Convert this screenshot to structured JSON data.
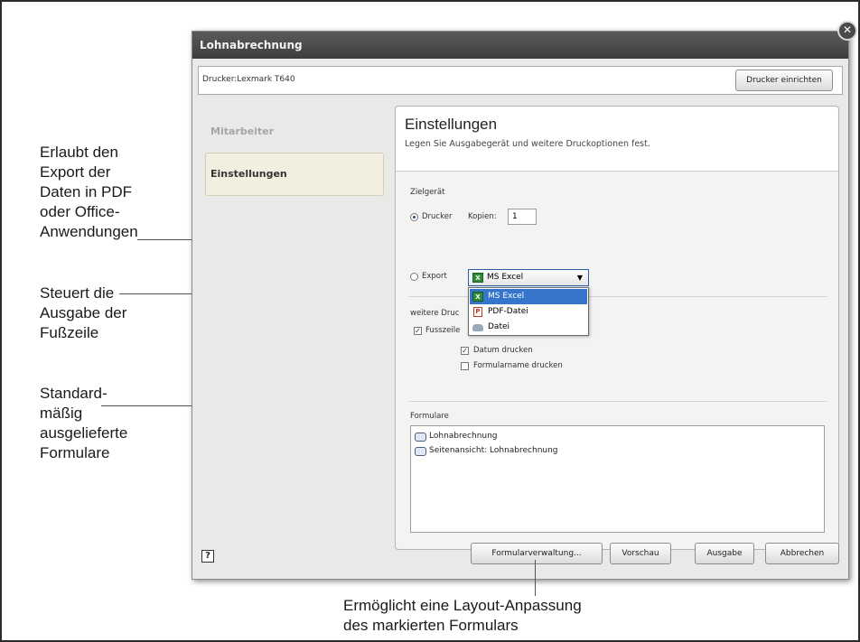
{
  "annotations": {
    "export": [
      "Erlaubt den",
      "Export der",
      "Daten in PDF",
      "oder Office-",
      "Anwendungen"
    ],
    "footer": [
      "Steuert die",
      "Ausgabe der",
      "Fußzeile"
    ],
    "forms": [
      "Standard-",
      "mäßig",
      "ausgelieferte",
      "Formulare"
    ],
    "layout": [
      "Ermöglicht eine Layout-Anpassung",
      "des markierten Formulars"
    ]
  },
  "dialog": {
    "title": "Lohnabrechnung",
    "close_glyph": "✕",
    "printer_label": "Drucker:Lexmark T640",
    "setup_printer_button": "Drucker einrichten"
  },
  "nav": {
    "items": [
      {
        "label": "Mitarbeiter",
        "active": false
      },
      {
        "label": "Einstellungen",
        "active": true
      }
    ]
  },
  "settings": {
    "title": "Einstellungen",
    "subtitle": "Legen Sie Ausgabegerät und weitere Druckoptionen fest.",
    "target_label": "Zielgerät",
    "radio_printer": "Drucker",
    "copies_label": "Kopien:",
    "copies_value": "1",
    "radio_export": "Export",
    "export_selected": "MS Excel",
    "export_options": [
      "MS Excel",
      "PDF-Datei",
      "Datei"
    ],
    "more_options_label": "weitere Druc",
    "footer_checkbox": "Fusszeile",
    "date_checkbox": "Datum drucken",
    "formname_checkbox": "Formularname drucken",
    "forms_label": "Formulare",
    "forms": [
      "Lohnabrechnung",
      "Seitenansicht: Lohnabrechnung"
    ]
  },
  "footer": {
    "help_glyph": "?",
    "form_manager_button": "Formularverwaltung...",
    "preview_button": "Vorschau",
    "output_button": "Ausgabe",
    "cancel_button": "Abbrechen"
  },
  "colors": {
    "titlebar": "#3d3d3d",
    "selection": "#3575cc",
    "active_nav": "#f2efe0"
  }
}
